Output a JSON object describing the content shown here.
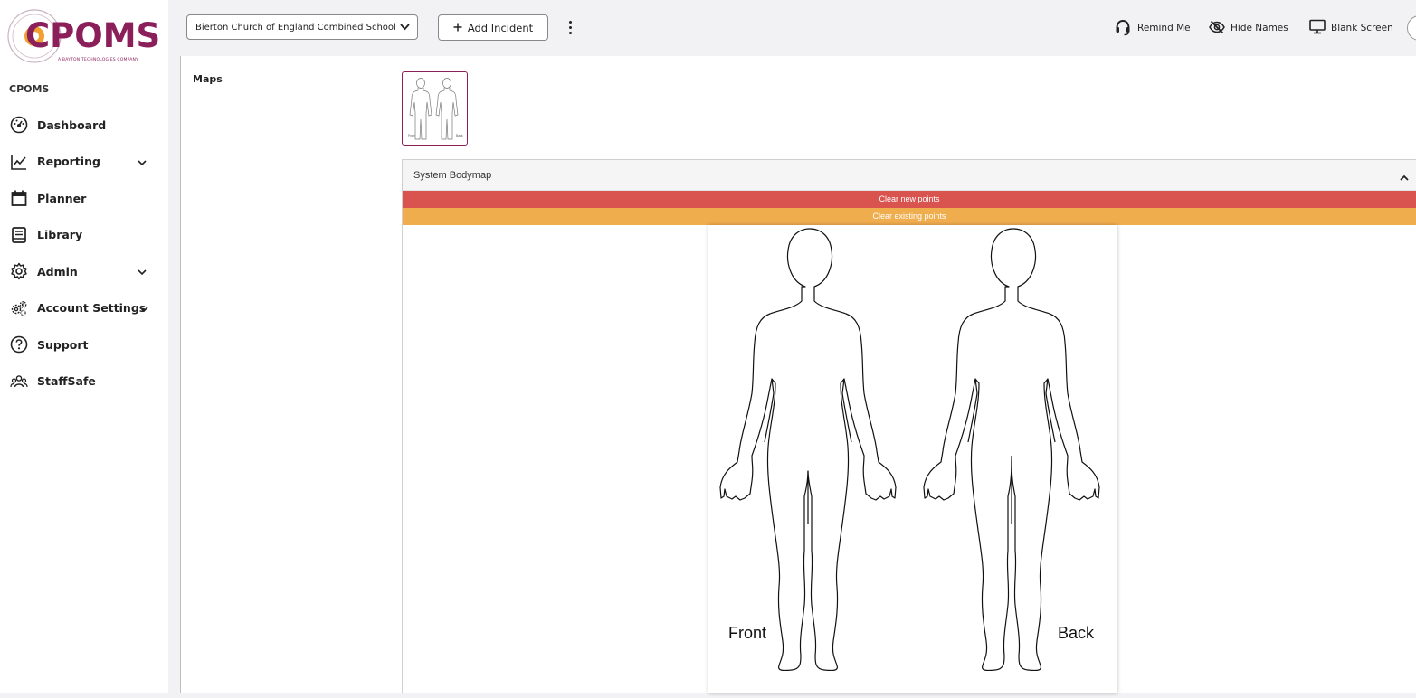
{
  "brand": {
    "name": "CPOMS",
    "tagline": "A BAYTON TECHNOLOGIES COMPANY",
    "color": "#8a1f5a",
    "accent": "#f0a030"
  },
  "sidebar": {
    "heading": "CPOMS",
    "items": [
      {
        "label": "Dashboard",
        "icon": "dashboard-gauge-icon",
        "has_chevron": false
      },
      {
        "label": "Reporting",
        "icon": "chart-line-icon",
        "has_chevron": true
      },
      {
        "label": "Planner",
        "icon": "calendar-icon",
        "has_chevron": false
      },
      {
        "label": "Library",
        "icon": "book-icon",
        "has_chevron": false
      },
      {
        "label": "Admin",
        "icon": "gear-icon",
        "has_chevron": true
      },
      {
        "label": "Account Settings",
        "icon": "gears-icon",
        "has_chevron": true
      },
      {
        "label": "Support",
        "icon": "question-circle-icon",
        "has_chevron": false
      },
      {
        "label": "StaffSafe",
        "icon": "users-icon",
        "has_chevron": false
      }
    ]
  },
  "topbar": {
    "school_select_value": "Bierton Church of England Combined School",
    "add_incident_label": "Add Incident",
    "add_incident_icon": "plus-icon",
    "actions": [
      {
        "label": "Remind Me",
        "icon": "headset-icon"
      },
      {
        "label": "Hide Names",
        "icon": "eye-slash-icon"
      },
      {
        "label": "Blank Screen",
        "icon": "monitor-icon"
      }
    ]
  },
  "main": {
    "maps_label": "Maps",
    "panel": {
      "title": "System Bodymap",
      "clear_new_label": "Clear new points",
      "clear_existing_label": "Clear existing points",
      "clear_new_color": "#d9534f",
      "clear_existing_color": "#f0ad4e",
      "front_label": "Front",
      "back_label": "Back"
    }
  }
}
